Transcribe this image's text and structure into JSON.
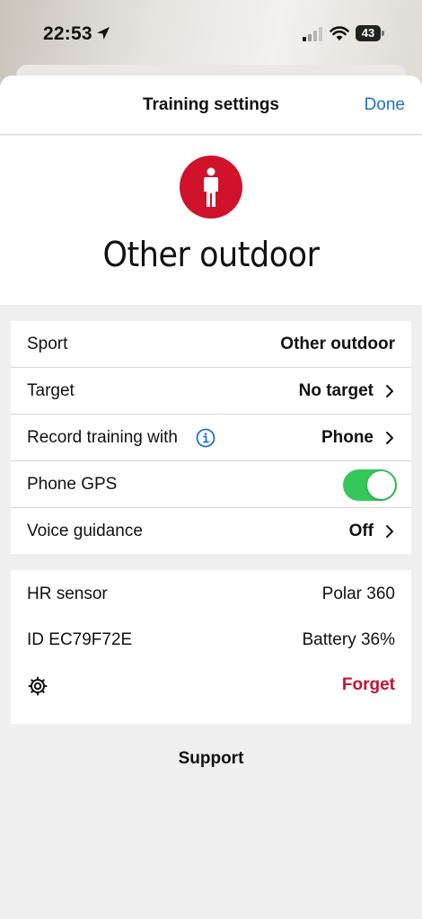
{
  "status_bar": {
    "time": "22:53",
    "battery": "43"
  },
  "header": {
    "title": "Training settings",
    "done_label": "Done"
  },
  "hero": {
    "sport_name": "Other outdoor"
  },
  "settings": {
    "sport": {
      "label": "Sport",
      "value": "Other outdoor"
    },
    "target": {
      "label": "Target",
      "value": "No target"
    },
    "record": {
      "label": "Record training with",
      "value": "Phone"
    },
    "gps": {
      "label": "Phone GPS",
      "enabled": true
    },
    "voice": {
      "label": "Voice guidance",
      "value": "Off"
    }
  },
  "sensor": {
    "label": "HR sensor",
    "name": "Polar 360",
    "id": "ID EC79F72E",
    "battery": "Battery 36%",
    "forget_label": "Forget"
  },
  "footer": {
    "support_label": "Support"
  },
  "colors": {
    "accent": "#1a73c9",
    "sport_badge": "#d0122a",
    "forget": "#c8102e",
    "toggle_on": "#34c759"
  }
}
